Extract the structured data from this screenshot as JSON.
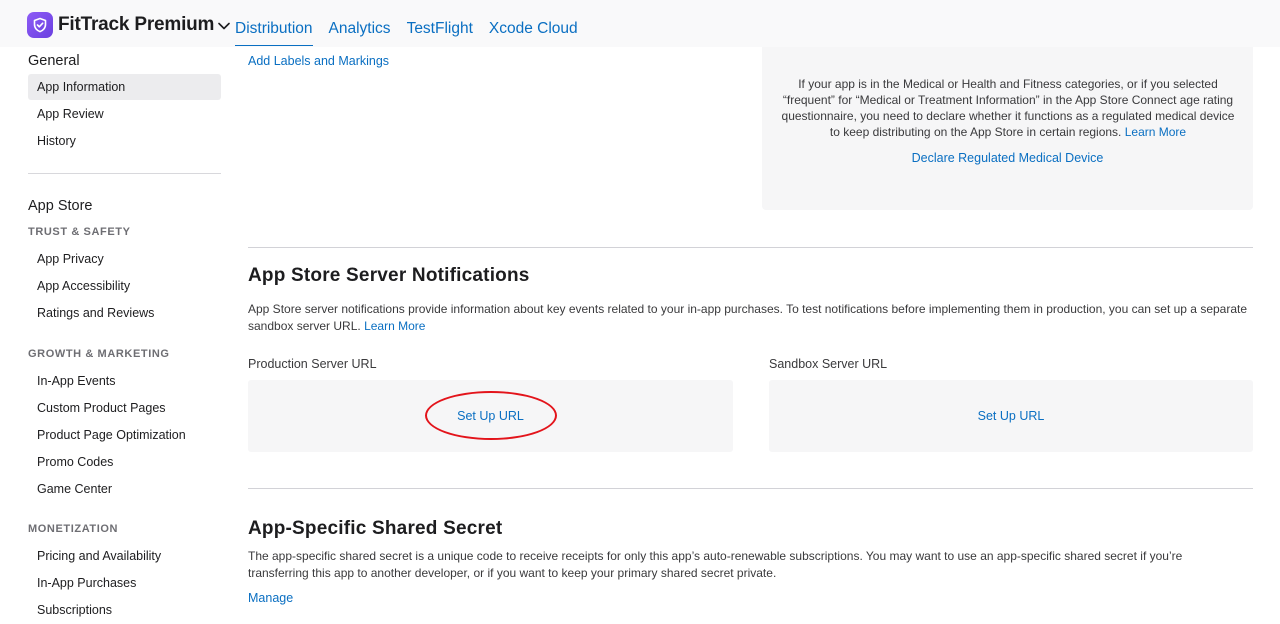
{
  "header": {
    "app_name": "FitTrack Premium",
    "tabs": [
      {
        "label": "Distribution",
        "active": true
      },
      {
        "label": "Analytics"
      },
      {
        "label": "TestFlight"
      },
      {
        "label": "Xcode Cloud"
      }
    ]
  },
  "sidebar": {
    "general": {
      "title": "General",
      "items": [
        "App Information",
        "App Review",
        "History"
      ]
    },
    "app_store": {
      "title": "App Store",
      "trust_safety": {
        "title": "TRUST & SAFETY",
        "items": [
          "App Privacy",
          "App Accessibility",
          "Ratings and Reviews"
        ]
      },
      "growth_marketing": {
        "title": "GROWTH & MARKETING",
        "items": [
          "In-App Events",
          "Custom Product Pages",
          "Product Page Optimization",
          "Promo Codes",
          "Game Center"
        ]
      },
      "monetization": {
        "title": "MONETIZATION",
        "items": [
          "Pricing and Availability",
          "In-App Purchases",
          "Subscriptions"
        ]
      }
    }
  },
  "main": {
    "add_labels_link": "Add Labels and Markings",
    "medical": {
      "text": "If your app is in the Medical or Health and Fitness categories, or if you selected “frequent” for “Medical or Treatment Information” in the App Store Connect age rating questionnaire, you need to declare whether it functions as a regulated medical device to keep distributing on the App Store in certain regions.",
      "learn_more": "Learn More",
      "declare_link": "Declare Regulated Medical Device"
    },
    "notifications": {
      "title": "App Store Server Notifications",
      "description": "App Store server notifications provide information about key events related to your in-app purchases. To test notifications before implementing them in production, you can set up a separate sandbox server URL.",
      "learn_more": "Learn More",
      "production_label": "Production Server URL",
      "production_action": "Set Up URL",
      "sandbox_label": "Sandbox Server URL",
      "sandbox_action": "Set Up URL"
    },
    "shared_secret": {
      "title": "App-Specific Shared Secret",
      "description": "The app-specific shared secret is a unique code to receive receipts for only this app’s auto-renewable subscriptions. You may want to use an app-specific shared secret if you’re transferring this app to another developer, or if you want to keep your primary shared secret private.",
      "manage": "Manage"
    }
  },
  "colors": {
    "link": "#0a6fc2",
    "annotation": "#e3141b",
    "app_icon": "#7b4bea"
  }
}
